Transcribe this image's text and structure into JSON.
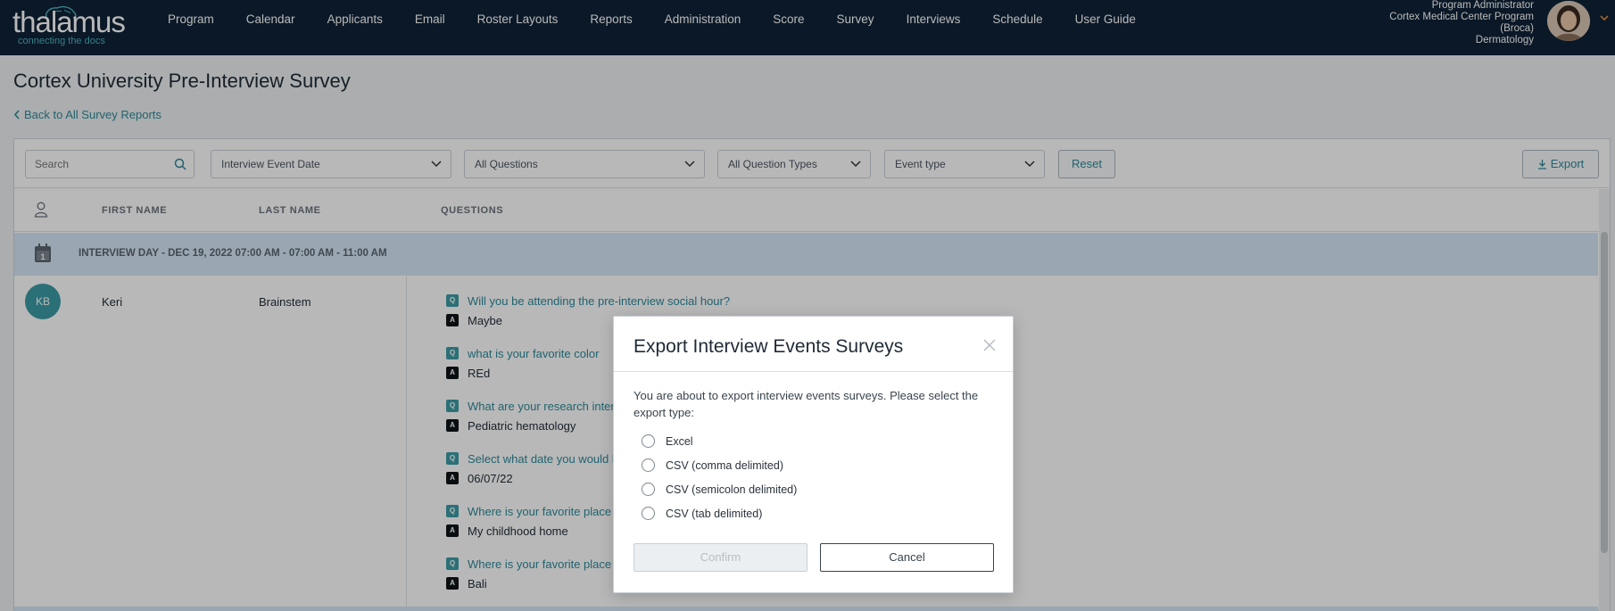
{
  "brand": {
    "name": "thalamus",
    "tagline": "connecting the docs"
  },
  "nav": {
    "items": [
      "Program",
      "Calendar",
      "Applicants",
      "Email",
      "Roster Layouts",
      "Reports",
      "Administration",
      "Score",
      "Survey",
      "Interviews",
      "Schedule",
      "User Guide"
    ]
  },
  "user": {
    "role": "Program Administrator",
    "program": "Cortex Medical Center Program",
    "site": "(Broca)",
    "specialty": "Dermatology"
  },
  "page": {
    "title": "Cortex University Pre-Interview Survey",
    "back_link": "Back to All Survey Reports"
  },
  "filters": {
    "search_placeholder": "Search",
    "event_date": "Interview Event Date",
    "questions": "All Questions",
    "question_types": "All Question Types",
    "event_type": "Event type",
    "reset_label": "Reset",
    "export_label": "Export"
  },
  "table": {
    "headers": [
      "FIRST NAME",
      "LAST NAME",
      "QUESTIONS"
    ],
    "group_label": "INTERVIEW DAY - DEC 19, 2022 07:00 AM - 07:00 AM - 11:00 AM",
    "row": {
      "initials": "KB",
      "first_name": "Keri",
      "last_name": "Brainstem",
      "qa": [
        {
          "q": "Will you be attending the pre-interview social hour?",
          "a": "Maybe"
        },
        {
          "q": "what is your favorite color",
          "a": "REd"
        },
        {
          "q": "What are your research intere",
          "a": "Pediatric hematology"
        },
        {
          "q": "Select what date you would li",
          "a": "06/07/22"
        },
        {
          "q": "Where is your favorite place t",
          "a": "My childhood home"
        },
        {
          "q": "Where is your favorite place t",
          "a": "Bali"
        }
      ],
      "q_badge": "Q",
      "a_badge": "A"
    }
  },
  "modal": {
    "title": "Export Interview Events Surveys",
    "description": "You are about to export interview events surveys. Please select the export type:",
    "options": [
      "Excel",
      "CSV (comma delimited)",
      "CSV (semicolon delimited)",
      "CSV (tab delimited)"
    ],
    "confirm_label": "Confirm",
    "cancel_label": "Cancel"
  },
  "colors": {
    "nav_bg": "#0e2236",
    "accent": "#2d8a9a",
    "group_row_bg": "#d6e6f5",
    "avatar_bg": "#3c9ba6"
  }
}
